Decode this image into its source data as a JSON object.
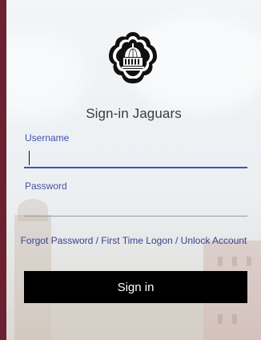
{
  "login": {
    "title": "Sign-in Jaguars",
    "username_label": "Username",
    "username_value": "",
    "password_label": "Password",
    "password_value": "",
    "forgot_link": "Forgot Password / First Time Logon / Unlock Account",
    "signin_button": "Sign in"
  },
  "colors": {
    "frame": "#6b2130",
    "accent": "#3f51b5",
    "button": "#000000",
    "logo": "#111111"
  },
  "icons": {
    "logo": "dome-emblem-icon"
  }
}
